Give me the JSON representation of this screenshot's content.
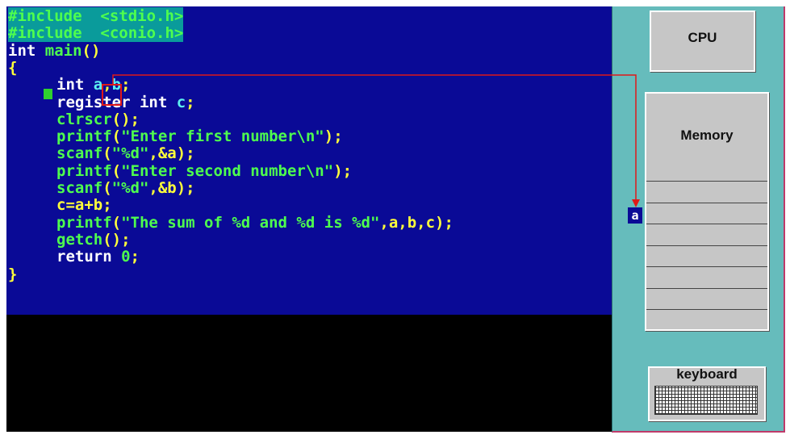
{
  "code": {
    "lines": [
      {
        "text": "#include  <stdio.h>",
        "tokens": [
          {
            "t": "#include  <stdio.h>",
            "c": "green",
            "hl": true
          }
        ]
      },
      {
        "text": "#include  <conio.h>",
        "tokens": [
          {
            "t": "#include  <conio.h>",
            "c": "green",
            "hl": true
          }
        ]
      },
      {
        "text": "int main()",
        "tokens": [
          {
            "t": "int ",
            "c": "white"
          },
          {
            "t": "main",
            "c": "green"
          },
          {
            "t": "()",
            "c": "yellow"
          }
        ]
      },
      {
        "text": "{",
        "tokens": [
          {
            "t": "{",
            "c": "yellow"
          }
        ]
      },
      {
        "text": "  int a,b;",
        "tokens": [
          {
            "t": "   ",
            "c": "white"
          },
          {
            "t": "int ",
            "c": "white"
          },
          {
            "t": "a",
            "c": "cyan"
          },
          {
            "t": ",",
            "c": "yellow"
          },
          {
            "t": "b",
            "c": "cyan"
          },
          {
            "t": ";",
            "c": "yellow"
          }
        ]
      },
      {
        "text": "  register int c;",
        "tokens": [
          {
            "t": "   ",
            "c": "white"
          },
          {
            "t": "register int ",
            "c": "white"
          },
          {
            "t": "c",
            "c": "cyan"
          },
          {
            "t": ";",
            "c": "yellow"
          }
        ]
      },
      {
        "text": "  clrscr();",
        "tokens": [
          {
            "t": "   ",
            "c": "white"
          },
          {
            "t": "clrscr",
            "c": "green"
          },
          {
            "t": "();",
            "c": "yellow"
          }
        ]
      },
      {
        "text": "  printf(\"Enter first number\\n\");",
        "tokens": [
          {
            "t": "   ",
            "c": "white"
          },
          {
            "t": "printf",
            "c": "green"
          },
          {
            "t": "(",
            "c": "yellow"
          },
          {
            "t": "\"Enter first number\\n\"",
            "c": "green"
          },
          {
            "t": ");",
            "c": "yellow"
          }
        ]
      },
      {
        "text": "  scanf(\"%d\",&a);",
        "tokens": [
          {
            "t": "   ",
            "c": "white"
          },
          {
            "t": "scanf",
            "c": "green"
          },
          {
            "t": "(",
            "c": "yellow"
          },
          {
            "t": "\"%d\"",
            "c": "green"
          },
          {
            "t": ",&a);",
            "c": "yellow"
          }
        ]
      },
      {
        "text": "  printf(\"Enter second number\\n\");",
        "tokens": [
          {
            "t": "   ",
            "c": "white"
          },
          {
            "t": "printf",
            "c": "green"
          },
          {
            "t": "(",
            "c": "yellow"
          },
          {
            "t": "\"Enter second number\\n\"",
            "c": "green"
          },
          {
            "t": ");",
            "c": "yellow"
          }
        ]
      },
      {
        "text": "  scanf(\"%d\",&b);",
        "tokens": [
          {
            "t": "   ",
            "c": "white"
          },
          {
            "t": "scanf",
            "c": "green"
          },
          {
            "t": "(",
            "c": "yellow"
          },
          {
            "t": "\"%d\"",
            "c": "green"
          },
          {
            "t": ",&b);",
            "c": "yellow"
          }
        ]
      },
      {
        "text": "  c=a+b;",
        "tokens": [
          {
            "t": "   ",
            "c": "white"
          },
          {
            "t": "c=a+b;",
            "c": "yellow"
          }
        ]
      },
      {
        "text": "  printf(\"The sum of %d and %d is %d\",a,b,c);",
        "tokens": [
          {
            "t": "   ",
            "c": "white"
          },
          {
            "t": "printf",
            "c": "green"
          },
          {
            "t": "(",
            "c": "yellow"
          },
          {
            "t": "\"The sum of %d and %d is %d\"",
            "c": "green"
          },
          {
            "t": ",a,b,c);",
            "c": "yellow"
          }
        ]
      },
      {
        "text": "  getch();",
        "tokens": [
          {
            "t": "   ",
            "c": "white"
          },
          {
            "t": "getch",
            "c": "green"
          },
          {
            "t": "();",
            "c": "yellow"
          }
        ]
      },
      {
        "text": "  return 0;",
        "tokens": [
          {
            "t": "   ",
            "c": "white"
          },
          {
            "t": "return ",
            "c": "white"
          },
          {
            "t": "0",
            "c": "green"
          },
          {
            "t": ";",
            "c": "yellow"
          }
        ]
      },
      {
        "text": "}",
        "tokens": [
          {
            "t": "}",
            "c": "yellow"
          }
        ]
      }
    ]
  },
  "panel": {
    "cpu_label": "CPU",
    "memory_label": "Memory",
    "memory_cells": 7,
    "keyboard_label": "keyboard",
    "variable_tag": "a"
  },
  "colors": {
    "editor_bg": "#0a0a96",
    "console_bg": "#000000",
    "panel_bg": "#66bcbc",
    "box_bg": "#c6c6c6",
    "arrow": "#e01818",
    "code_green": "#4eff4e",
    "code_yellow": "#ffff3a",
    "code_white": "#ffffff",
    "code_cyan": "#5cf0f0",
    "include_highlight": "#0a9b9b"
  }
}
